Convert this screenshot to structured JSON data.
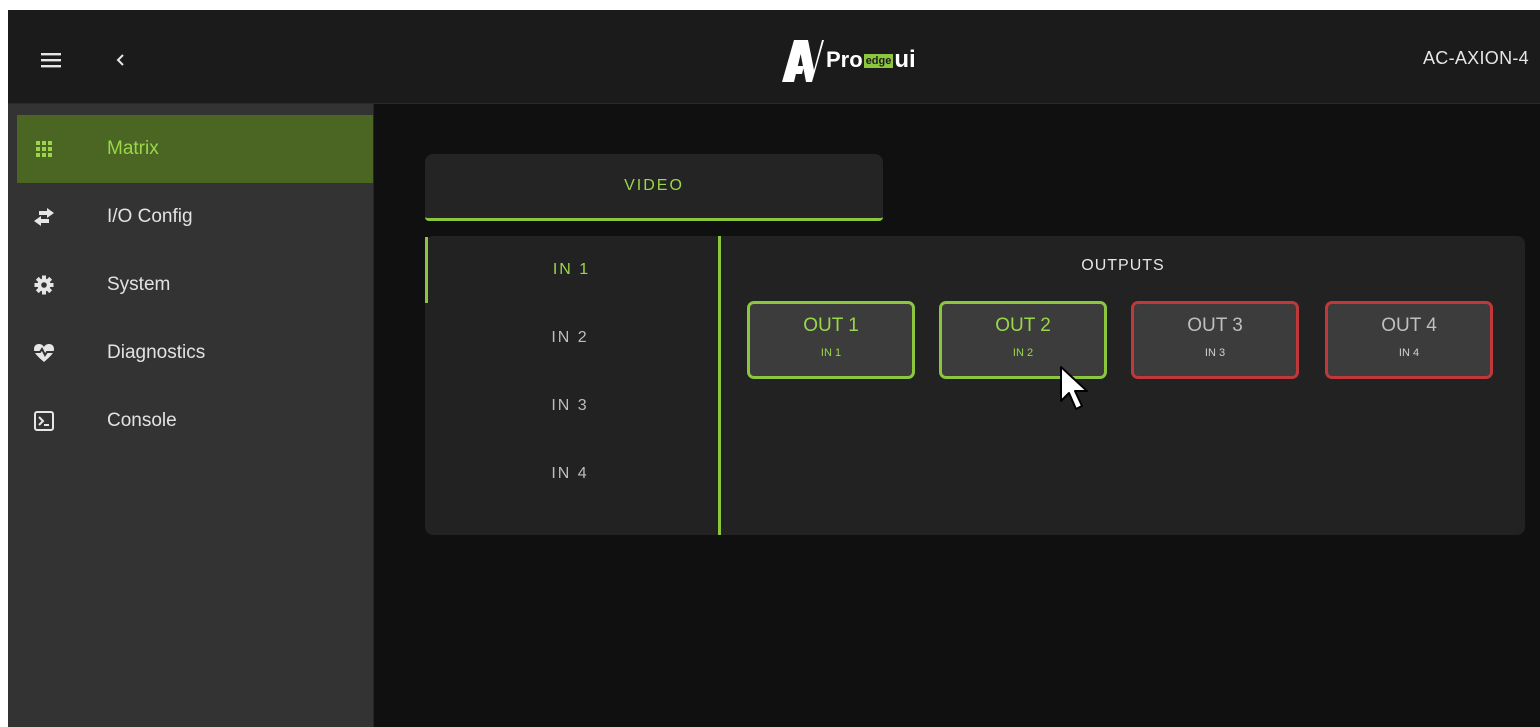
{
  "header": {
    "menu_icon": "hamburger-menu-icon",
    "back_icon": "chevron-left-icon",
    "logo": {
      "av": "AV",
      "pro": "Pro",
      "edge": "edge",
      "ui": "ui"
    },
    "device_name": "AC-AXION-4"
  },
  "sidebar": {
    "items": [
      {
        "label": "Matrix",
        "icon": "grid-icon",
        "active": true
      },
      {
        "label": "I/O Config",
        "icon": "swap-arrows-icon",
        "active": false
      },
      {
        "label": "System",
        "icon": "gear-icon",
        "active": false
      },
      {
        "label": "Diagnostics",
        "icon": "heart-pulse-icon",
        "active": false
      },
      {
        "label": "Console",
        "icon": "terminal-icon",
        "active": false
      }
    ]
  },
  "main": {
    "tabs": [
      {
        "label": "VIDEO",
        "active": true
      }
    ],
    "inputs": [
      {
        "label": "IN 1",
        "active": true
      },
      {
        "label": "IN 2",
        "active": false
      },
      {
        "label": "IN 3",
        "active": false
      },
      {
        "label": "IN 4",
        "active": false
      }
    ],
    "outputs_title": "OUTPUTS",
    "outputs": [
      {
        "label": "OUT 1",
        "source": "IN 1",
        "state": "routed"
      },
      {
        "label": "OUT 2",
        "source": "IN 2",
        "state": "routed"
      },
      {
        "label": "OUT 3",
        "source": "IN 3",
        "state": "not-routed"
      },
      {
        "label": "OUT 4",
        "source": "IN 4",
        "state": "not-routed"
      }
    ]
  },
  "colors": {
    "accent_green": "#8cc63f",
    "active_nav_bg": "#4a6622",
    "red_border": "#c0383a",
    "background": "#101010",
    "sidebar_bg": "#333333"
  }
}
